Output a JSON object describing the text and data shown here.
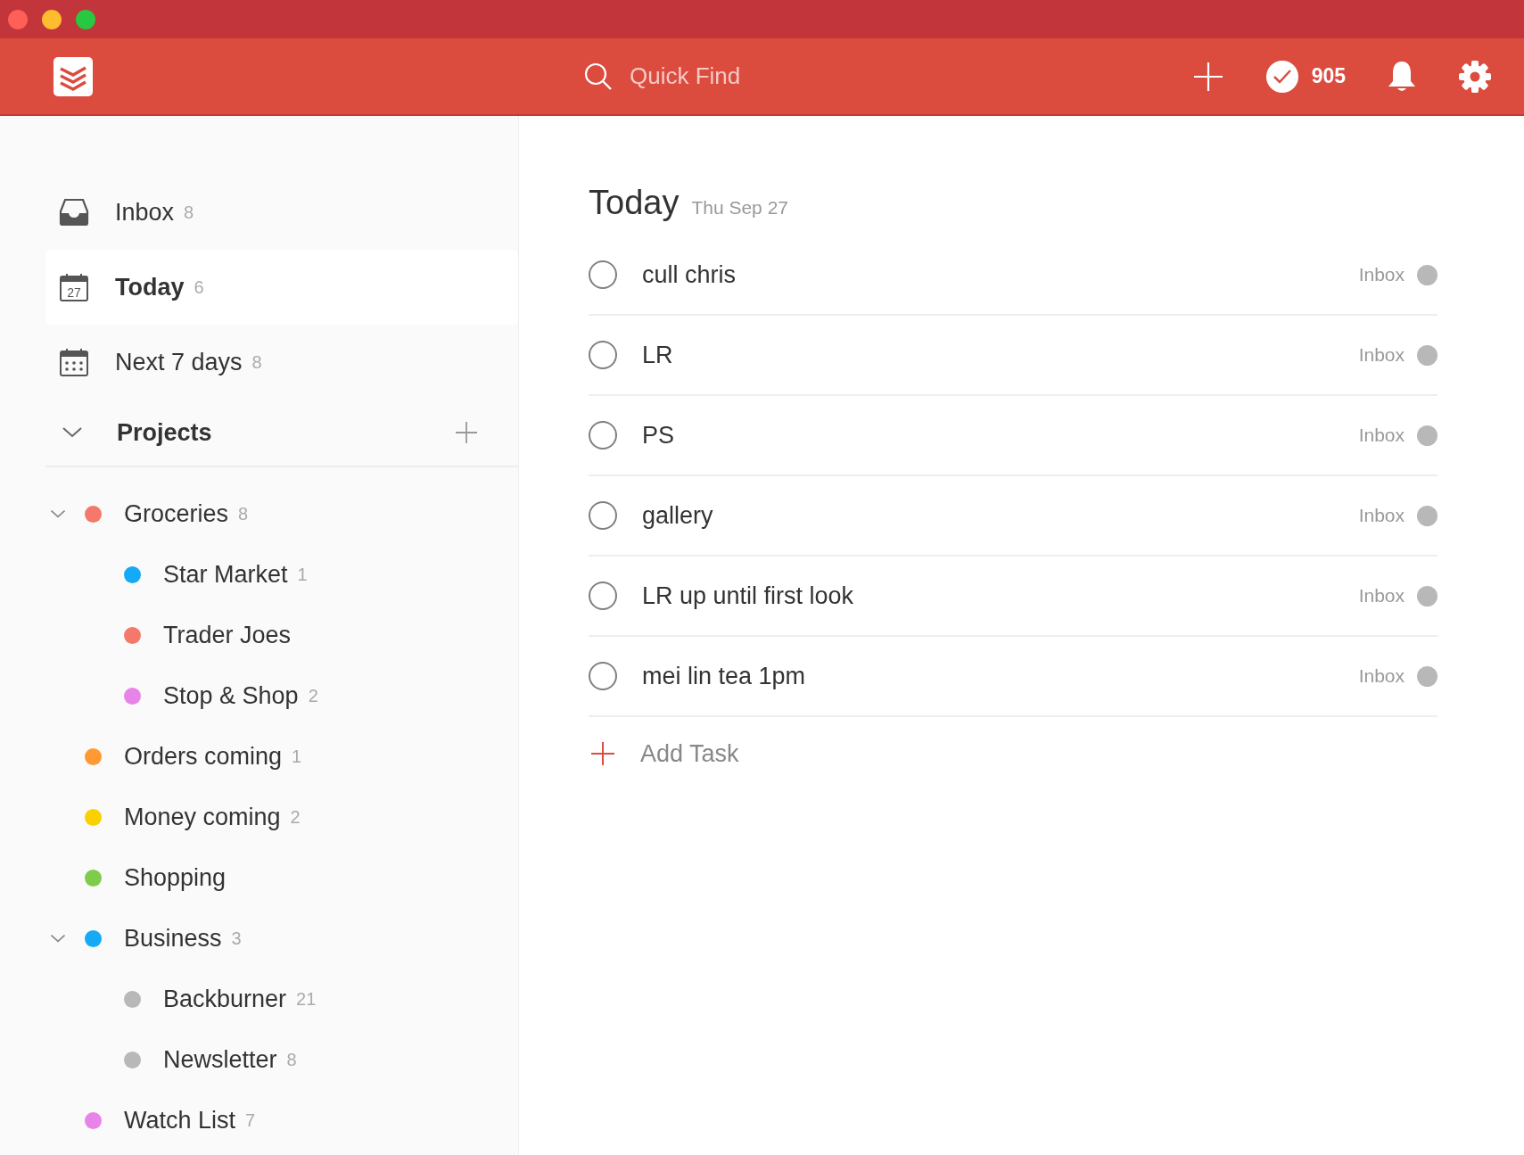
{
  "header": {
    "search": {
      "placeholder": "Quick Find"
    },
    "karma": "905"
  },
  "sidebar": {
    "nav": [
      {
        "kind": "inbox",
        "label": "Inbox",
        "count": "8",
        "selected": false
      },
      {
        "kind": "today",
        "label": "Today",
        "count": "6",
        "icon_text": "27",
        "selected": true
      },
      {
        "kind": "upcoming",
        "label": "Next 7 days",
        "count": "8",
        "selected": false
      }
    ],
    "projects_header": {
      "label": "Projects",
      "expanded": true
    },
    "projects": [
      {
        "name": "Groceries",
        "count": "8",
        "color": "#f4796b",
        "expanded": true,
        "children": [
          {
            "name": "Star Market",
            "count": "1",
            "color": "#14aaf5"
          },
          {
            "name": "Trader Joes",
            "color": "#f4796b"
          },
          {
            "name": "Stop & Shop",
            "count": "2",
            "color": "#e883e8"
          }
        ]
      },
      {
        "name": "Orders coming",
        "count": "1",
        "color": "#ff9933"
      },
      {
        "name": "Money coming",
        "count": "2",
        "color": "#fad000"
      },
      {
        "name": "Shopping",
        "color": "#7ecc49"
      },
      {
        "name": "Business",
        "count": "3",
        "color": "#14aaf5",
        "expanded": true,
        "children": [
          {
            "name": "Backburner",
            "count": "21",
            "color": "#b8b8b8"
          },
          {
            "name": "Newsletter",
            "count": "8",
            "color": "#b8b8b8"
          }
        ]
      },
      {
        "name": "Watch List",
        "count": "7",
        "color": "#e883e8"
      }
    ]
  },
  "main": {
    "title": "Today",
    "date": "Thu Sep 27",
    "tasks": [
      {
        "text": "cull chris",
        "checked": false,
        "project": "Inbox",
        "color": "#b8b8b8"
      },
      {
        "text": "LR",
        "checked": false,
        "project": "Inbox",
        "color": "#b8b8b8"
      },
      {
        "text": "PS",
        "checked": false,
        "project": "Inbox",
        "color": "#b8b8b8"
      },
      {
        "text": "gallery",
        "checked": false,
        "project": "Inbox",
        "color": "#b8b8b8"
      },
      {
        "text": "LR up until first look",
        "checked": false,
        "project": "Inbox",
        "color": "#b8b8b8"
      },
      {
        "text": "mei lin tea 1pm",
        "checked": false,
        "project": "Inbox",
        "color": "#b8b8b8"
      }
    ],
    "add_task": "Add Task"
  }
}
